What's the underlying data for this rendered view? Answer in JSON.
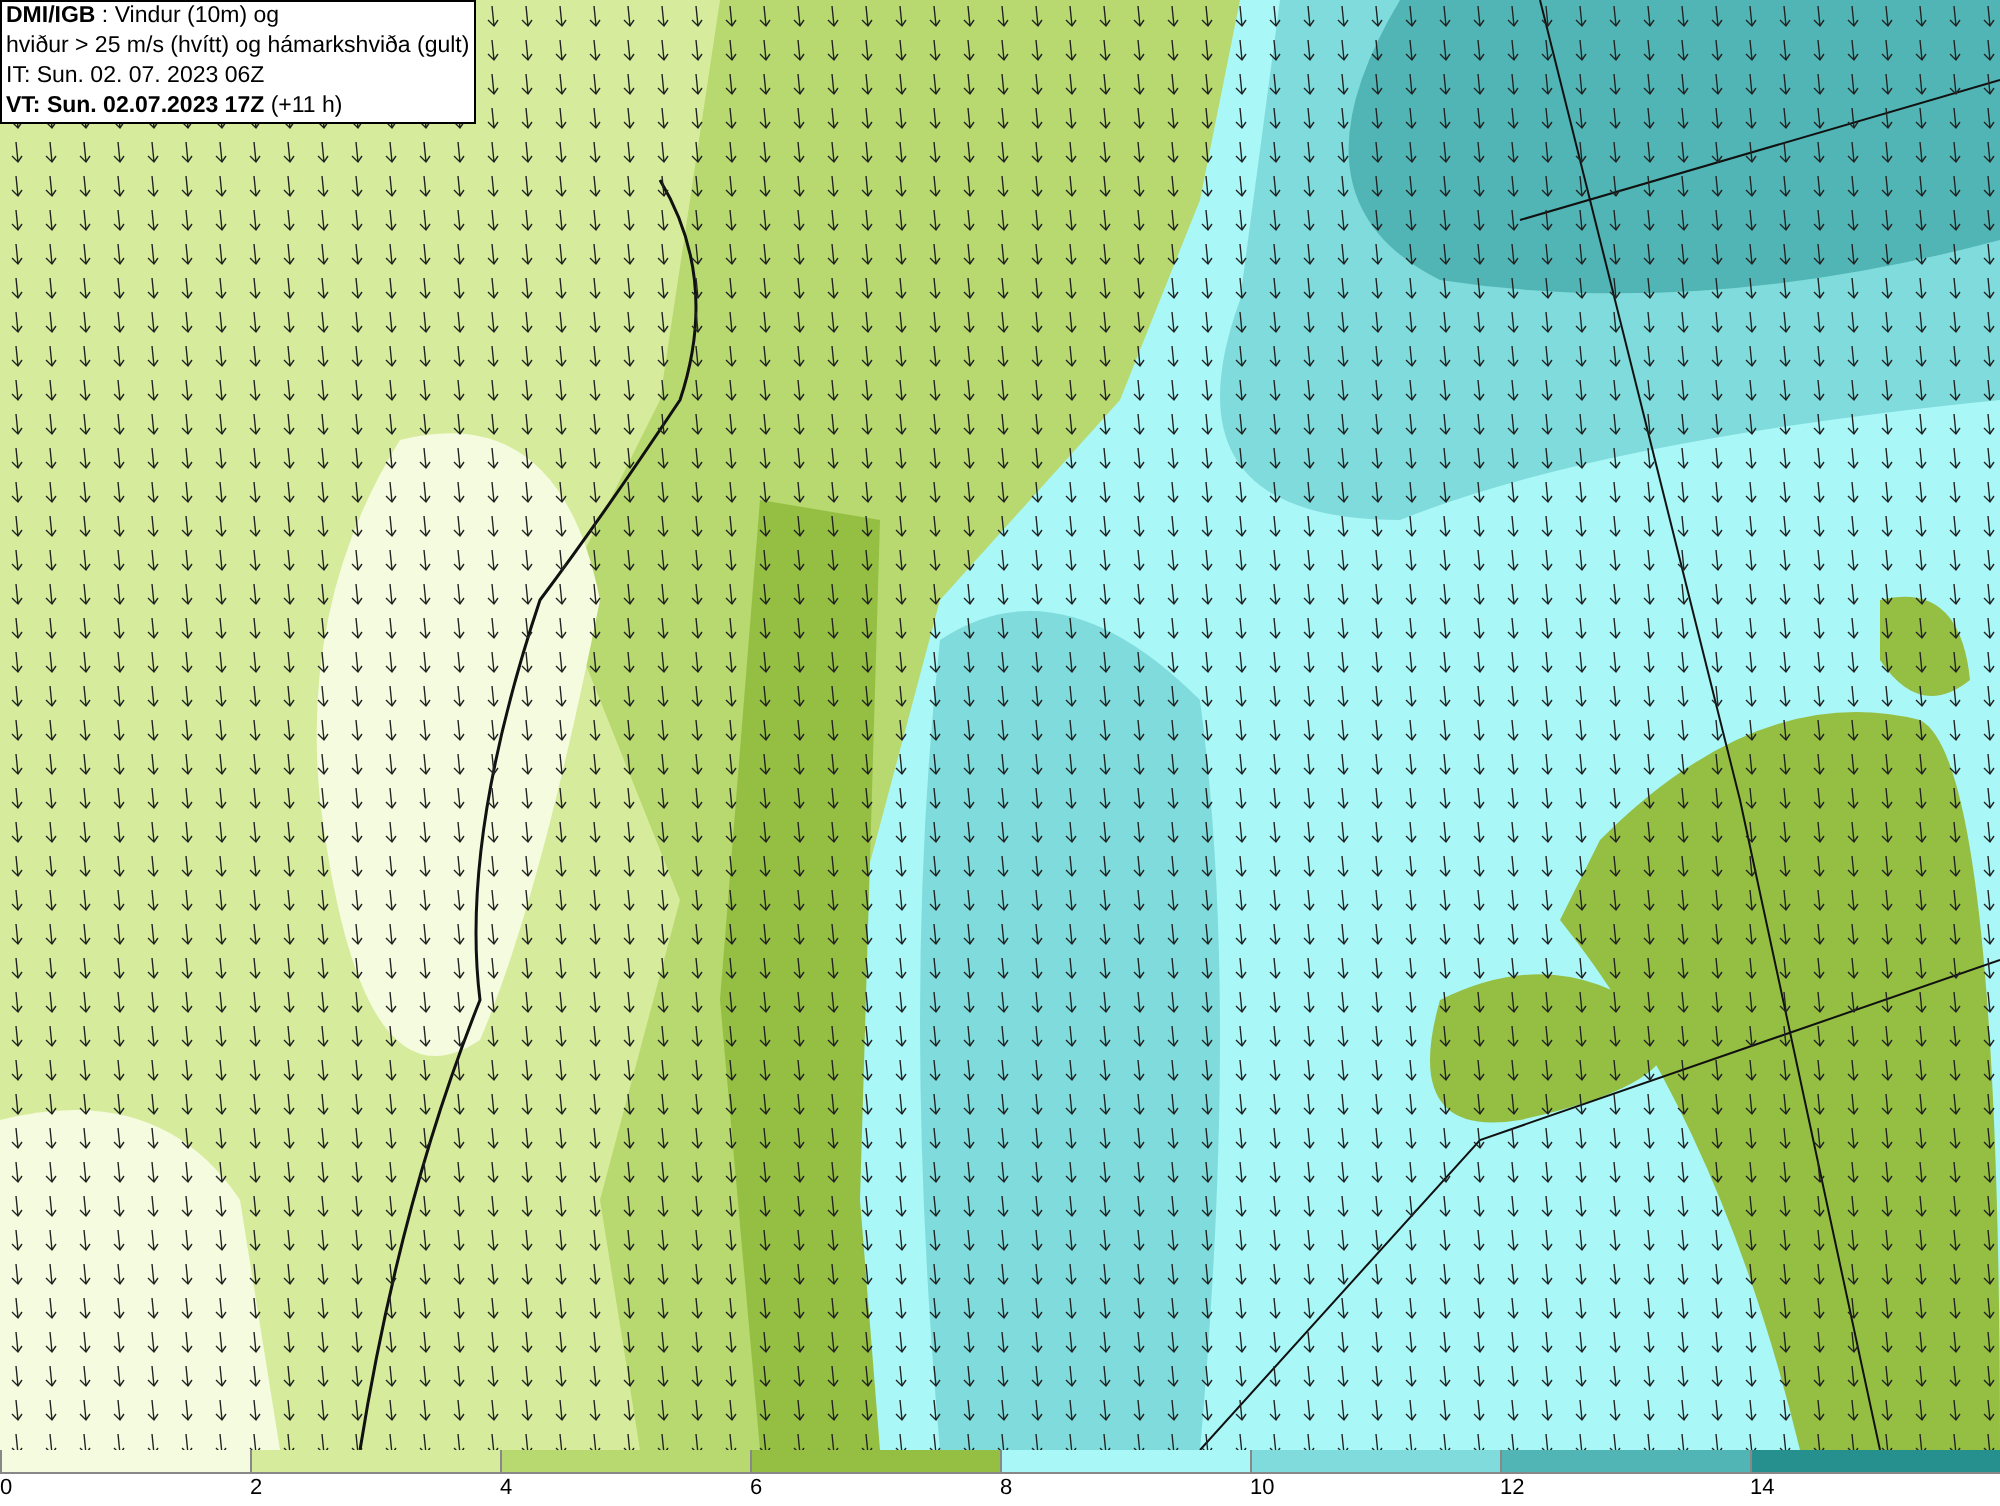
{
  "title_box": {
    "lines": [
      "**DMI/IGB** : Vindur (10m) og",
      "hviður > 25 m/s (hvítt) og hámarkshviða (gult)",
      "IT: Sun. 02. 07. 2023 06Z",
      "**VT: Sun. 02.07.2023 17Z** (+11 h)"
    ]
  },
  "legend": [
    {
      "label": "0",
      "color": "#f5fbdf"
    },
    {
      "label": "2",
      "color": "#d6ec9c"
    },
    {
      "label": "4",
      "color": "#b7d96f"
    },
    {
      "label": "6",
      "color": "#95bf43"
    },
    {
      "label": "8",
      "color": "#aaf7f7"
    },
    {
      "label": "10",
      "color": "#80dcdc"
    },
    {
      "label": "12",
      "color": "#52b5b5"
    },
    {
      "label": "14",
      "color": "#26908f"
    }
  ]
}
